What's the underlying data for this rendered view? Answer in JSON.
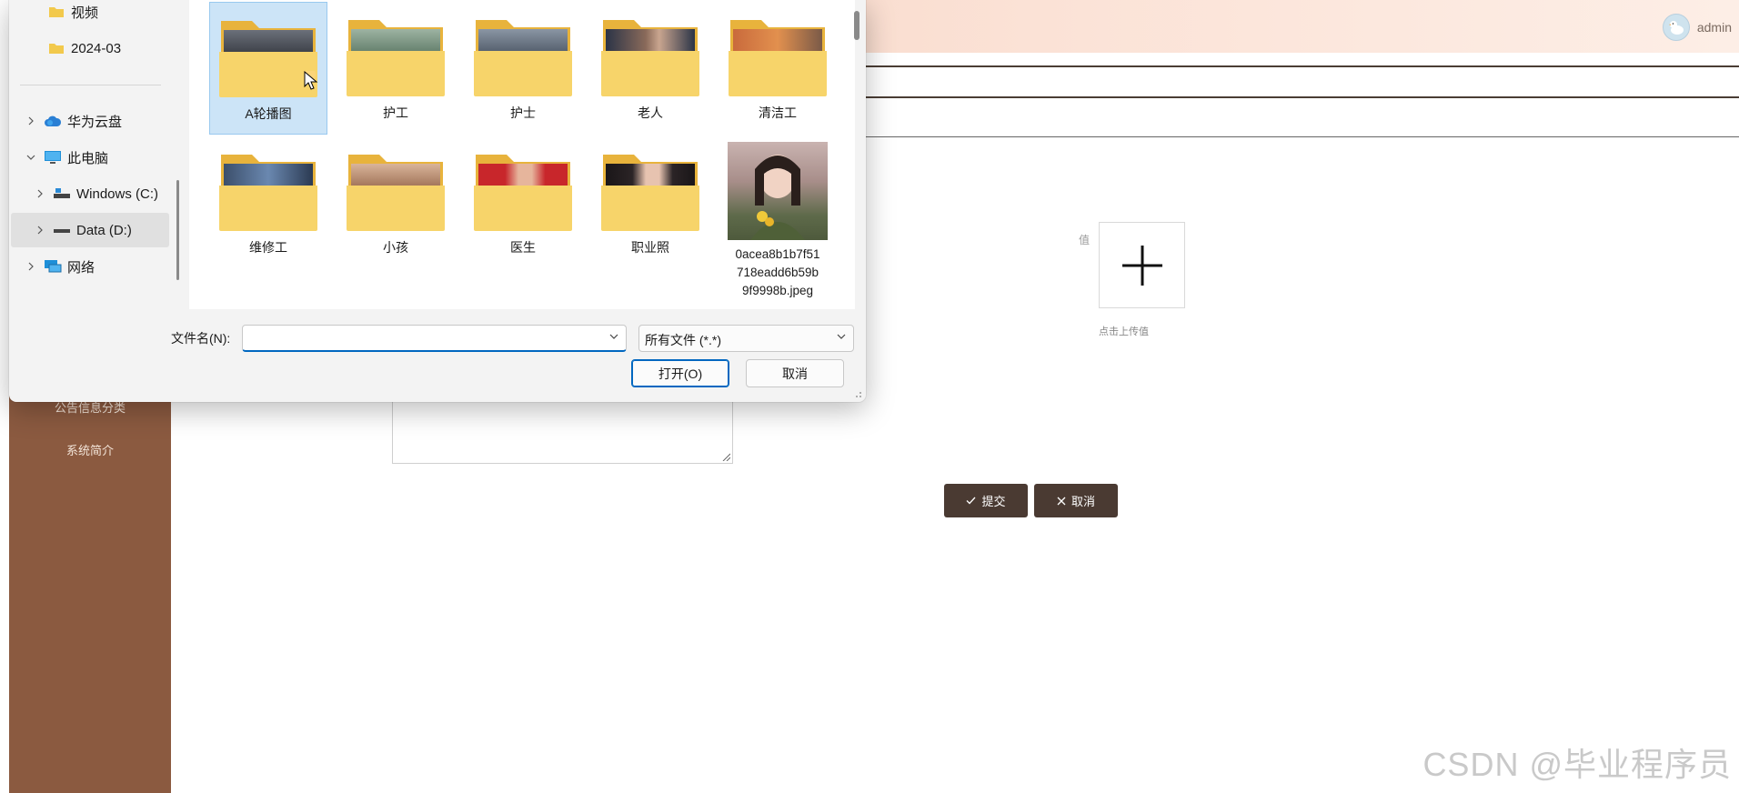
{
  "app": {
    "sidebar": {
      "items": [
        {
          "label": "公告信息分类"
        },
        {
          "label": "系统简介"
        }
      ]
    },
    "header": {
      "username": "admin"
    },
    "form": {
      "field_label": "值",
      "upload_hint": "点击上传值",
      "submit_label": "提交",
      "cancel_label": "取消"
    },
    "watermark": "CSDN @毕业程序员"
  },
  "dialog": {
    "nav": [
      {
        "label": "视频",
        "icon": "folder-icon",
        "expander": false
      },
      {
        "label": "2024-03",
        "icon": "folder-icon",
        "expander": false
      },
      {
        "label": "华为云盘",
        "icon": "cloud-icon",
        "expander": "collapsed"
      },
      {
        "label": "此电脑",
        "icon": "computer-icon",
        "expander": "expanded"
      },
      {
        "label": "Windows (C:)",
        "icon": "drive-icon",
        "expander": "collapsed"
      },
      {
        "label": "Data (D:)",
        "icon": "drive-icon",
        "expander": "collapsed",
        "selected": true
      },
      {
        "label": "网络",
        "icon": "network-icon",
        "expander": "collapsed"
      }
    ],
    "files": [
      {
        "name": "A轮播图",
        "type": "folder",
        "selected": true,
        "tint": "#3a3f48"
      },
      {
        "name": "护工",
        "type": "folder",
        "tint": "#6f8a74"
      },
      {
        "name": "护士",
        "type": "folder",
        "tint": "#5d6b7d"
      },
      {
        "name": "老人",
        "type": "folder",
        "tint": "#5a4a44"
      },
      {
        "name": "清洁工",
        "type": "folder",
        "tint": "#b0553a"
      },
      {
        "name": "维修工",
        "type": "folder",
        "tint": "#4a5f80"
      },
      {
        "name": "小孩",
        "type": "folder",
        "tint": "#a77d62"
      },
      {
        "name": "医生",
        "type": "folder",
        "tint": "#c8262b"
      },
      {
        "name": "职业照",
        "type": "folder",
        "tint": "#2f2a2c"
      },
      {
        "name": "0acea8b1b7f51718eadd6b59b9f9998b.jpeg",
        "name_lines": [
          "0acea8b1b7f51",
          "718eadd6b59b",
          "9f9998b.jpeg"
        ],
        "type": "image"
      }
    ],
    "filename_label": "文件名(N):",
    "filename_value": "",
    "filter_value": "所有文件 (*.*)",
    "open_label": "打开(O)",
    "cancel_label": "取消"
  },
  "colors": {
    "sidebar_bg": "#8b5a40",
    "button_dark": "#4a3a32",
    "selection_blue": "#cce4f7",
    "accent_blue": "#0067c0"
  }
}
